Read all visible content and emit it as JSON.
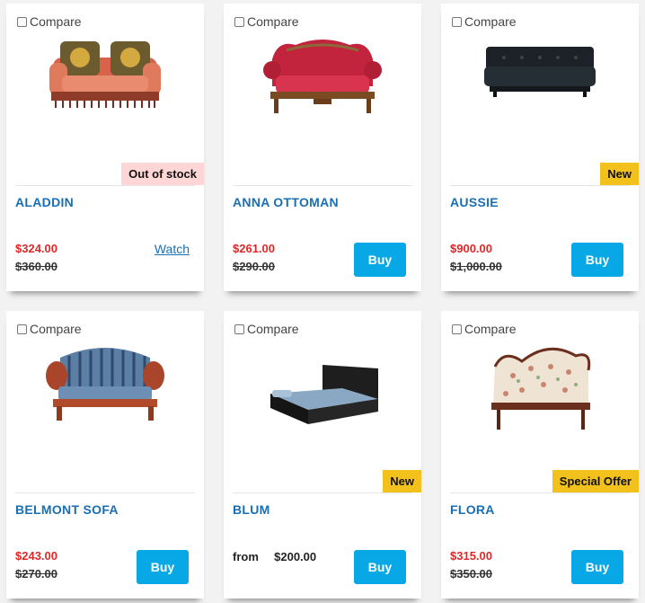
{
  "compare_label": "Compare",
  "buy_label": "Buy",
  "products": [
    {
      "name": "ALADDIN",
      "price": "$324.00",
      "old_price": "$360.00",
      "badge": "Out of stock",
      "action": "Watch",
      "image_icon": "sofa-aladdin-icon"
    },
    {
      "name": "ANNA OTTOMAN",
      "price": "$261.00",
      "old_price": "$290.00",
      "badge": "",
      "action": "Buy",
      "image_icon": "sofa-anna-icon"
    },
    {
      "name": "AUSSIE",
      "price": "$900.00",
      "old_price": "$1,000.00",
      "badge": "New",
      "action": "Buy",
      "image_icon": "sofa-aussie-icon"
    },
    {
      "name": "BELMONT SOFA",
      "price": "$243.00",
      "old_price": "$270.00",
      "badge": "",
      "action": "Buy",
      "image_icon": "sofa-belmont-icon"
    },
    {
      "name": "BLUM",
      "from_label": "from",
      "from_price": "$200.00",
      "badge": "New",
      "action": "Buy",
      "image_icon": "bed-blum-icon"
    },
    {
      "name": "FLORA",
      "price": "$315.00",
      "old_price": "$350.00",
      "badge": "Special Offer",
      "action": "Buy",
      "image_icon": "sofa-flora-icon"
    }
  ],
  "colors": {
    "title_blue": "#1a6fb3",
    "price_red": "#e02828",
    "buy_blue": "#08a8e6",
    "badge_new": "#f2c11b",
    "badge_oos": "#ffd6d6"
  }
}
